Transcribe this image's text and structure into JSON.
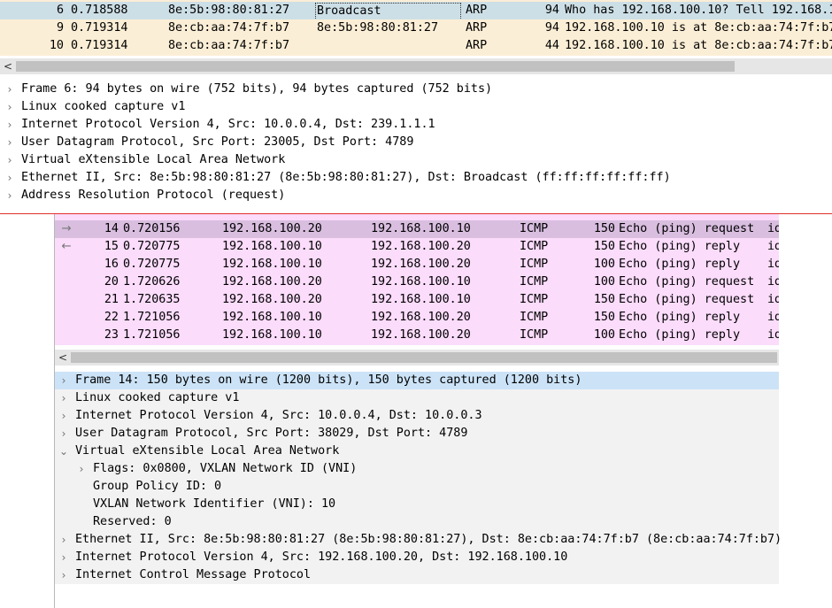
{
  "top_window": {
    "packets": [
      {
        "no": "6",
        "time": "0.718588",
        "source": "8e:5b:98:80:81:27",
        "destination": "Broadcast",
        "protocol": "ARP",
        "length": "94",
        "info": "Who has 192.168.100.10? Tell 192.168.1"
      },
      {
        "no": "9",
        "time": "0.719314",
        "source": "8e:cb:aa:74:7f:b7",
        "destination": "8e:5b:98:80:81:27",
        "protocol": "ARP",
        "length": "94",
        "info": "192.168.100.10 is at 8e:cb:aa:74:7f:b7"
      },
      {
        "no": "10",
        "time": "0.719314",
        "source": "8e:cb:aa:74:7f:b7",
        "destination": "",
        "protocol": "ARP",
        "length": "44",
        "info": "192.168.100.10 is at 8e:cb:aa:74:7f:b7"
      }
    ],
    "scroll_left_glyph": "<",
    "details": [
      {
        "text": "Frame 6: 94 bytes on wire (752 bits), 94 bytes captured (752 bits)",
        "expanded": false
      },
      {
        "text": "Linux cooked capture v1",
        "expanded": false
      },
      {
        "text": "Internet Protocol Version 4, Src: 10.0.0.4, Dst: 239.1.1.1",
        "expanded": false
      },
      {
        "text": "User Datagram Protocol, Src Port: 23005, Dst Port: 4789",
        "expanded": false
      },
      {
        "text": "Virtual eXtensible Local Area Network",
        "expanded": false
      },
      {
        "text": "Ethernet II, Src: 8e:5b:98:80:81:27 (8e:5b:98:80:81:27), Dst: Broadcast (ff:ff:ff:ff:ff:ff)",
        "expanded": false
      },
      {
        "text": "Address Resolution Protocol (request)",
        "expanded": false
      }
    ]
  },
  "bottom_window": {
    "packets": [
      {
        "no": "14",
        "time": "0.720156",
        "source": "192.168.100.20",
        "destination": "192.168.100.10",
        "protocol": "ICMP",
        "length": "150",
        "info": "Echo (ping) request",
        "trunc": "id",
        "mark": "→"
      },
      {
        "no": "15",
        "time": "0.720775",
        "source": "192.168.100.10",
        "destination": "192.168.100.20",
        "protocol": "ICMP",
        "length": "150",
        "info": "Echo (ping) reply",
        "trunc": "id",
        "mark": "←"
      },
      {
        "no": "16",
        "time": "0.720775",
        "source": "192.168.100.10",
        "destination": "192.168.100.20",
        "protocol": "ICMP",
        "length": "100",
        "info": "Echo (ping) reply",
        "trunc": "id",
        "mark": ""
      },
      {
        "no": "20",
        "time": "1.720626",
        "source": "192.168.100.20",
        "destination": "192.168.100.10",
        "protocol": "ICMP",
        "length": "100",
        "info": "Echo (ping) request",
        "trunc": "id",
        "mark": ""
      },
      {
        "no": "21",
        "time": "1.720635",
        "source": "192.168.100.20",
        "destination": "192.168.100.10",
        "protocol": "ICMP",
        "length": "150",
        "info": "Echo (ping) request",
        "trunc": "id",
        "mark": ""
      },
      {
        "no": "22",
        "time": "1.721056",
        "source": "192.168.100.10",
        "destination": "192.168.100.20",
        "protocol": "ICMP",
        "length": "150",
        "info": "Echo (ping) reply",
        "trunc": "id",
        "mark": ""
      },
      {
        "no": "23",
        "time": "1.721056",
        "source": "192.168.100.10",
        "destination": "192.168.100.20",
        "protocol": "ICMP",
        "length": "100",
        "info": "Echo (ping) reply",
        "trunc": "id",
        "mark": ""
      }
    ],
    "scroll_left_glyph": "<",
    "details": [
      {
        "text": "Frame 14: 150 bytes on wire (1200 bits), 150 bytes captured (1200 bits)",
        "level": 0,
        "chevron": ">"
      },
      {
        "text": "Linux cooked capture v1",
        "level": 0,
        "chevron": ">"
      },
      {
        "text": "Internet Protocol Version 4, Src: 10.0.0.4, Dst: 10.0.0.3",
        "level": 0,
        "chevron": ">"
      },
      {
        "text": "User Datagram Protocol, Src Port: 38029, Dst Port: 4789",
        "level": 0,
        "chevron": ">"
      },
      {
        "text": "Virtual eXtensible Local Area Network",
        "level": 0,
        "chevron": "v"
      },
      {
        "text": "Flags: 0x0800, VXLAN Network ID (VNI)",
        "level": 1,
        "chevron": ">"
      },
      {
        "text": "Group Policy ID: 0",
        "level": 1,
        "chevron": ""
      },
      {
        "text": "VXLAN Network Identifier (VNI): 10",
        "level": 1,
        "chevron": ""
      },
      {
        "text": "Reserved: 0",
        "level": 1,
        "chevron": ""
      },
      {
        "text": "Ethernet II, Src: 8e:5b:98:80:81:27 (8e:5b:98:80:81:27), Dst: 8e:cb:aa:74:7f:b7 (8e:cb:aa:74:7f:b7)",
        "level": 0,
        "chevron": ">"
      },
      {
        "text": "Internet Protocol Version 4, Src: 192.168.100.20, Dst: 192.168.100.10",
        "level": 0,
        "chevron": ">"
      },
      {
        "text": "Internet Control Message Protocol",
        "level": 0,
        "chevron": ">"
      }
    ]
  },
  "colors": {
    "arp_row_bg": "#fbeed6",
    "selected_row_bg": "#cddfe6",
    "icmp_row_bg": "#fbdcfb",
    "icmp_selected_bg": "#d9bee0",
    "detail_selected_bg": "#cce3f7",
    "separator": "#e0302a"
  }
}
